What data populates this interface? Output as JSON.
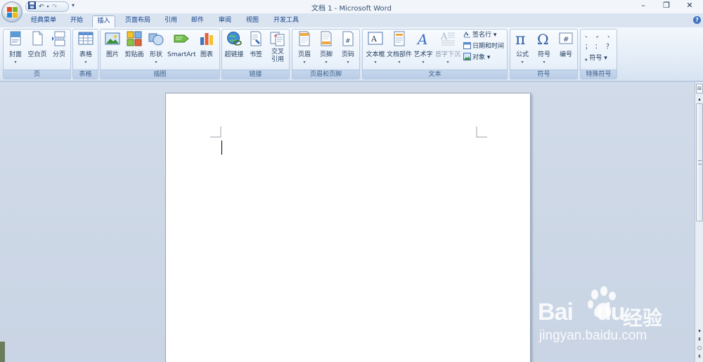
{
  "titlebar": {
    "title": "文档 1 - Microsoft Word",
    "qat_more": "▾"
  },
  "window_controls": {
    "minimize": "–",
    "restore": "❐",
    "close": "✕"
  },
  "tabs": [
    "经典菜单",
    "开始",
    "插入",
    "页面布局",
    "引用",
    "邮件",
    "审阅",
    "视图",
    "开发工具"
  ],
  "active_tab": "插入",
  "help": "?",
  "ribbon": {
    "groups": [
      {
        "name": "页",
        "buttons": [
          "封面",
          "空白页",
          "分页"
        ]
      },
      {
        "name": "表格",
        "buttons": [
          "表格"
        ]
      },
      {
        "name": "插图",
        "buttons": [
          "图片",
          "剪贴画",
          "形状",
          "SmartArt",
          "图表"
        ]
      },
      {
        "name": "链接",
        "buttons": [
          "超链接",
          "书签",
          "交叉",
          "引用"
        ]
      },
      {
        "name": "页眉和页脚",
        "buttons": [
          "页眉",
          "页脚",
          "页码"
        ]
      },
      {
        "name": "文本",
        "buttons": [
          "文本框",
          "文档部件",
          "艺术字",
          "首字下沉"
        ],
        "small_buttons": [
          "签名行 ▾",
          "日期和时间",
          "对象 ▾"
        ]
      },
      {
        "name": "符号",
        "buttons": [
          "公式",
          "符号",
          "编号"
        ]
      },
      {
        "name": "特殊符号",
        "symbols": [
          "、",
          "。",
          "、",
          "；",
          "：",
          "？"
        ],
        "small_button": "符号 ▾"
      }
    ],
    "dropdown_mark": "▾"
  },
  "scrollbar": {
    "top_button": "⊟",
    "down_arrow": "▾",
    "prev_page": "⇞",
    "browse": "○",
    "next_page": "⇟"
  },
  "watermark": {
    "brand": "Bai",
    "brand2": "du",
    "cn": "经验",
    "url": "jingyan.baidu.com"
  },
  "colors": {
    "ribbon_bg": "#e3ecf7",
    "tab_text": "#15428b",
    "doc_bg": "#cfd8e6",
    "page": "#ffffff"
  }
}
